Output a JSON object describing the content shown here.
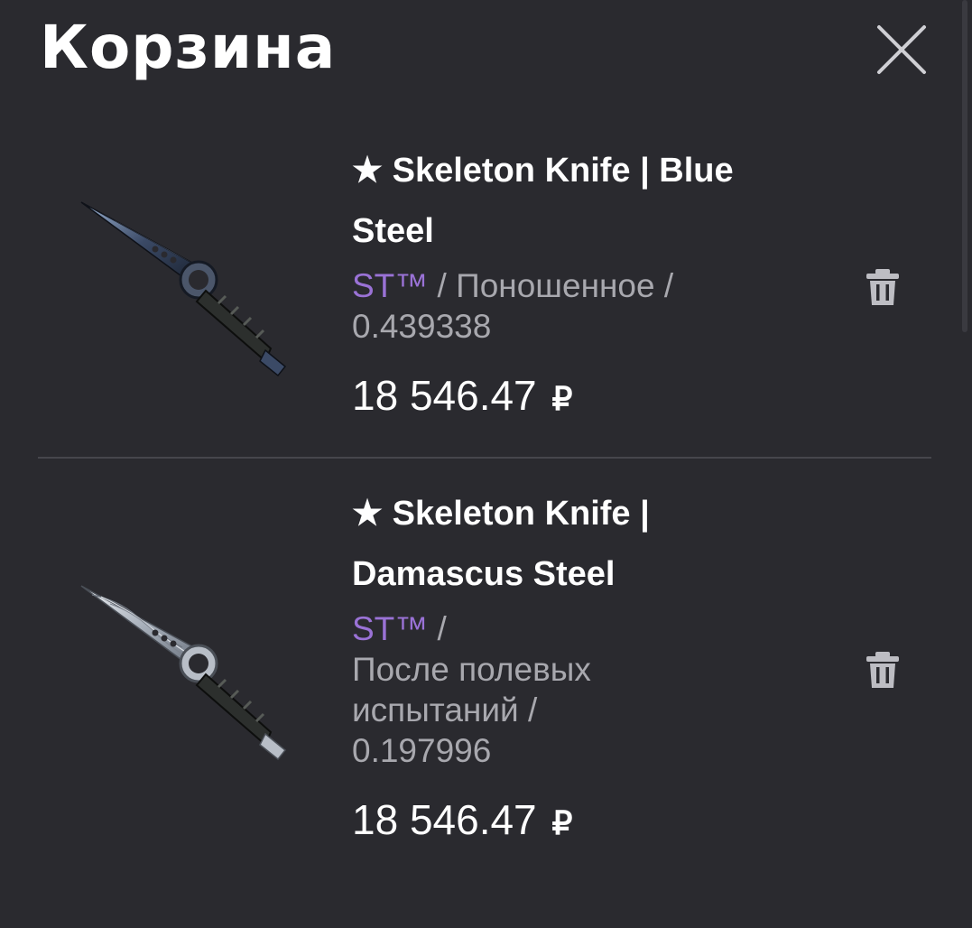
{
  "header": {
    "title": "Корзина",
    "close_icon": "close-icon"
  },
  "cart": {
    "items": [
      {
        "name": "★ Skeleton Knife | Blue Steel",
        "name_line1": "★ Skeleton Knife | Blue",
        "name_line2": "Steel",
        "badge": "ST™",
        "meta_rest_line1": " / Поношенное /",
        "meta_line2": "0.439338",
        "price": "18 546.47",
        "currency": "₽",
        "delete_icon": "trash-icon",
        "image_icon": "knife-blue-steel-image"
      },
      {
        "name": "★ Skeleton Knife | Damascus Steel",
        "name_line1": "★ Skeleton Knife |",
        "name_line2": "Damascus Steel",
        "badge": "ST™",
        "meta_rest_line1": " /",
        "meta_line2": "После полевых",
        "meta_line3": "испытаний /",
        "meta_line4": "0.197996",
        "price": "18 546.47",
        "currency": "₽",
        "delete_icon": "trash-icon",
        "image_icon": "knife-damascus-steel-image"
      }
    ]
  },
  "colors": {
    "background": "#2a2a2f",
    "stattrak_purple": "#9a72d6",
    "meta_grey": "#a8a8ae",
    "divider": "#46464c"
  }
}
